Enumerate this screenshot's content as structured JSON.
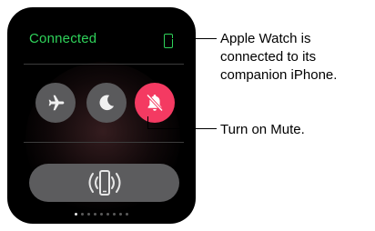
{
  "watch": {
    "status_text": "Connected",
    "status_color": "#2fd25a",
    "status_icon": "iphone-outline-icon",
    "buttons": [
      {
        "name": "airplane-mode-button",
        "icon": "airplane-icon",
        "active": false
      },
      {
        "name": "do-not-disturb-button",
        "icon": "moon-icon",
        "active": false
      },
      {
        "name": "mute-button",
        "icon": "bell-slash-icon",
        "active": true,
        "color": "#f43a62"
      }
    ],
    "ping_button_icon": "ping-iphone-icon",
    "page_dots": {
      "count": 9,
      "active_index": 0
    }
  },
  "callouts": {
    "connected_lines": [
      "Apple Watch is",
      "connected to its",
      "companion iPhone."
    ],
    "mute": "Turn on Mute."
  }
}
